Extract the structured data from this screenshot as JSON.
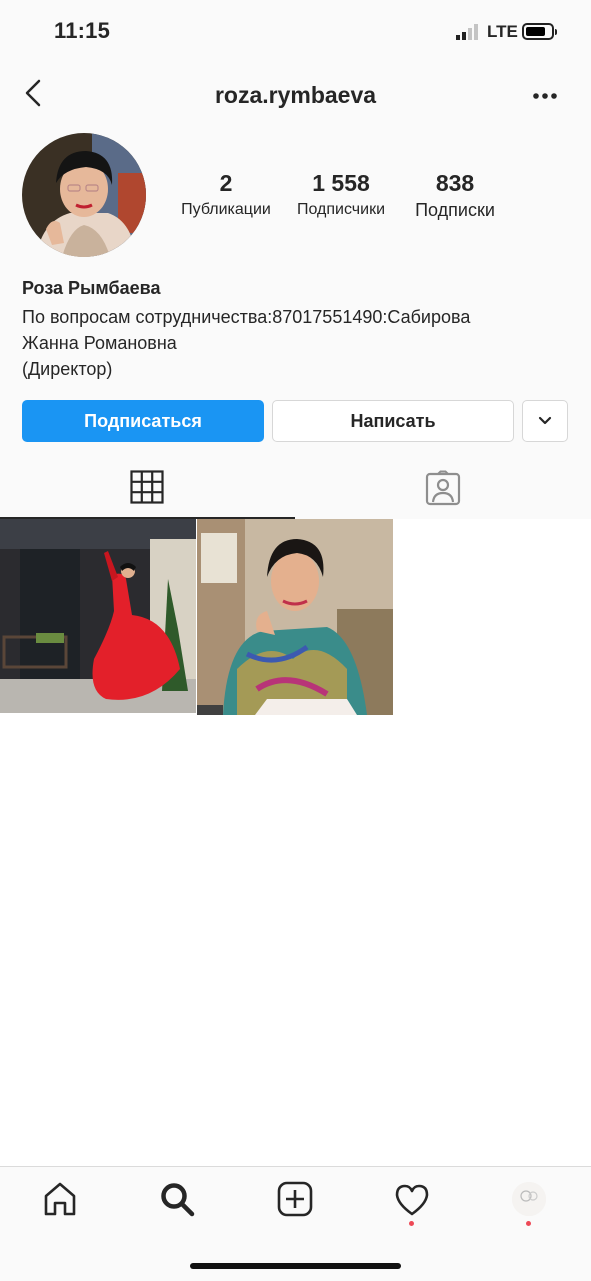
{
  "status_bar": {
    "time": "11:15",
    "network": "LTE",
    "signal_icon": "signal-bars-icon",
    "battery_icon": "battery-icon"
  },
  "header": {
    "username": "roza.rymbaeva",
    "back_icon": "chevron-left-icon",
    "more_icon": "ellipsis-icon"
  },
  "profile": {
    "stats": [
      {
        "value": "2",
        "label": "Публикации"
      },
      {
        "value": "1 558",
        "label": "Подписчики"
      },
      {
        "value": "838",
        "label": "Подписки"
      }
    ],
    "full_name": "Роза Рымбаева",
    "bio_lines": [
      "По вопросам сотрудничества:87017551490:Сабирова",
      "Жанна Романовна",
      "(Директор)"
    ]
  },
  "actions": {
    "follow_label": "Подписаться",
    "message_label": "Написать",
    "dropdown_icon": "chevron-down-icon"
  },
  "tabs": [
    {
      "icon": "grid-icon",
      "active": true
    },
    {
      "icon": "tagged-person-icon",
      "active": false
    }
  ],
  "posts": [
    {
      "alt": "woman in red dress dancing"
    },
    {
      "alt": "woman in colorful blouse seated"
    }
  ],
  "bottom_nav": [
    {
      "icon": "home-icon"
    },
    {
      "icon": "search-icon"
    },
    {
      "icon": "add-post-icon"
    },
    {
      "icon": "heart-icon",
      "notification_dot": true
    },
    {
      "icon": "profile-avatar-icon",
      "notification_dot": true
    }
  ],
  "colors": {
    "accent": "#1a95f3",
    "notification": "#ed4956",
    "text": "#262626",
    "border": "#dbdbdb"
  }
}
